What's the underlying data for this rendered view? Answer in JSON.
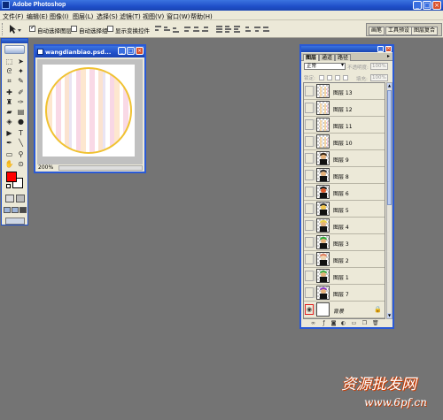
{
  "window": {
    "title": "Adobe Photoshop"
  },
  "menu": {
    "items": [
      "文件(F)",
      "编辑(E)",
      "图像(I)",
      "图层(L)",
      "选择(S)",
      "滤镜(T)",
      "视图(V)",
      "窗口(W)",
      "帮助(H)"
    ]
  },
  "options": {
    "auto_select_layer": "自动选择图层",
    "auto_select_group": "自动选择组",
    "show_transform": "显示变换控件",
    "auto_select_layer_checked": true,
    "auto_select_group_checked": false,
    "show_transform_checked": false,
    "well_tabs": [
      "画笔",
      "工具预设",
      "图层复合"
    ]
  },
  "document": {
    "title": "wangdianbiao.psd...",
    "zoom": "200%"
  },
  "layers_palette": {
    "tabs": [
      "图层",
      "通道",
      "路径"
    ],
    "blend_mode": "正常",
    "opacity_label": "不透明度:",
    "opacity_value": "100%",
    "lock_label": "锁定:",
    "fill_label": "填充:",
    "fill_value": "100%",
    "layers": [
      {
        "name": "图层 13",
        "thumb": "lines"
      },
      {
        "name": "图层 12",
        "thumb": "lines"
      },
      {
        "name": "图层 11",
        "thumb": "lines"
      },
      {
        "name": "图层 10",
        "thumb": "lines"
      },
      {
        "name": "图层 9",
        "thumb": "figure",
        "head": "#e7b27a",
        "hair": "#3a2a1a"
      },
      {
        "name": "图层 8",
        "thumb": "figure",
        "head": "#e7b27a",
        "hair": "#333"
      },
      {
        "name": "图层 6",
        "thumb": "figure",
        "head": "#e25b2b",
        "hair": "#222"
      },
      {
        "name": "图层 5",
        "thumb": "figure",
        "head": "#f3c64b",
        "hair": "#333"
      },
      {
        "name": "图层 4",
        "thumb": "figure",
        "head": "#e7b27a",
        "hair": "#e8d04a"
      },
      {
        "name": "图层 3",
        "thumb": "figure",
        "head": "#e7b27a",
        "hair": "#2faa3a"
      },
      {
        "name": "图层 2",
        "thumb": "figure",
        "head": "#f1d5b0",
        "hair": "#e08060"
      },
      {
        "name": "图层 1",
        "thumb": "figure",
        "head": "#e7b27a",
        "hair": "#43b04a"
      },
      {
        "name": "图层 7",
        "thumb": "figure",
        "head": "#e7b27a",
        "hair": "#8d3fc4"
      },
      {
        "name": "背景",
        "thumb": "blank",
        "visible": true,
        "locked": true
      }
    ]
  },
  "colors": {
    "foreground": "#ff0000",
    "background": "#ffffff",
    "title_bar": "#1f4fc9",
    "desktop": "#747474"
  },
  "watermark": {
    "cn": "资源批发网",
    "url": "www.6pf.cn"
  }
}
